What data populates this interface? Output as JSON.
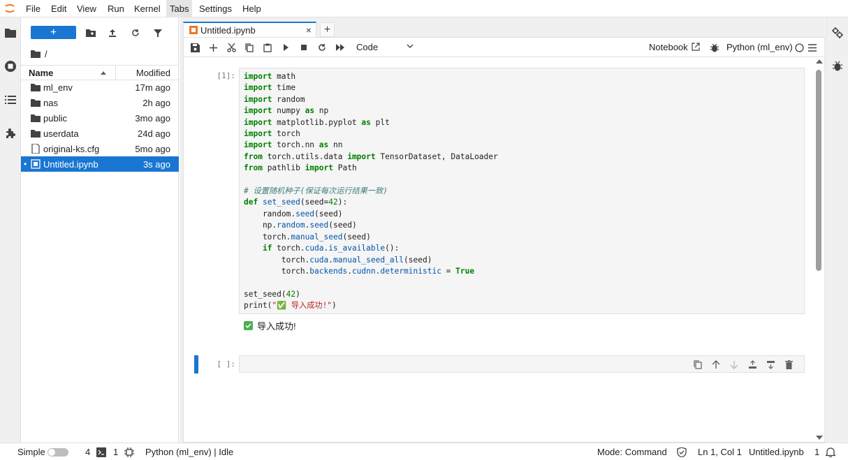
{
  "menubar": {
    "items": [
      "File",
      "Edit",
      "View",
      "Run",
      "Kernel",
      "Tabs",
      "Settings",
      "Help"
    ],
    "active": "Tabs"
  },
  "filebrowser": {
    "new_label": "+",
    "path": "/",
    "columns": {
      "name": "Name",
      "modified": "Modified"
    },
    "files": [
      {
        "name": "ml_env",
        "modified": "17m ago",
        "type": "folder"
      },
      {
        "name": "nas",
        "modified": "2h ago",
        "type": "folder"
      },
      {
        "name": "public",
        "modified": "3mo ago",
        "type": "folder"
      },
      {
        "name": "userdata",
        "modified": "24d ago",
        "type": "folder"
      },
      {
        "name": "original-ks.cfg",
        "modified": "5mo ago",
        "type": "file"
      },
      {
        "name": "Untitled.ipynb",
        "modified": "3s ago",
        "type": "notebook",
        "selected": true,
        "running_marker": "•"
      }
    ]
  },
  "tabs": {
    "doc_tab_label": "Untitled.ipynb",
    "close_glyph": "×",
    "add_glyph": "+"
  },
  "toolbar": {
    "cell_type": "Code",
    "notebook_label": "Notebook",
    "kernel_name": "Python (ml_env)"
  },
  "cells": [
    {
      "prompt": "[1]:",
      "output": "导入成功!"
    },
    {
      "prompt": "[ ]:"
    }
  ],
  "statusbar": {
    "simple_label": "Simple",
    "terminals_count": "4",
    "kernels_count": "1",
    "kernel_status": "Python (ml_env) | Idle",
    "mode": "Mode: Command",
    "cursor": "Ln 1, Col 1",
    "filename": "Untitled.ipynb",
    "notifications": "1"
  },
  "colors": {
    "accent": "#1976d2",
    "keyword": "#008000",
    "string": "#ba2121",
    "comment": "#408080"
  }
}
